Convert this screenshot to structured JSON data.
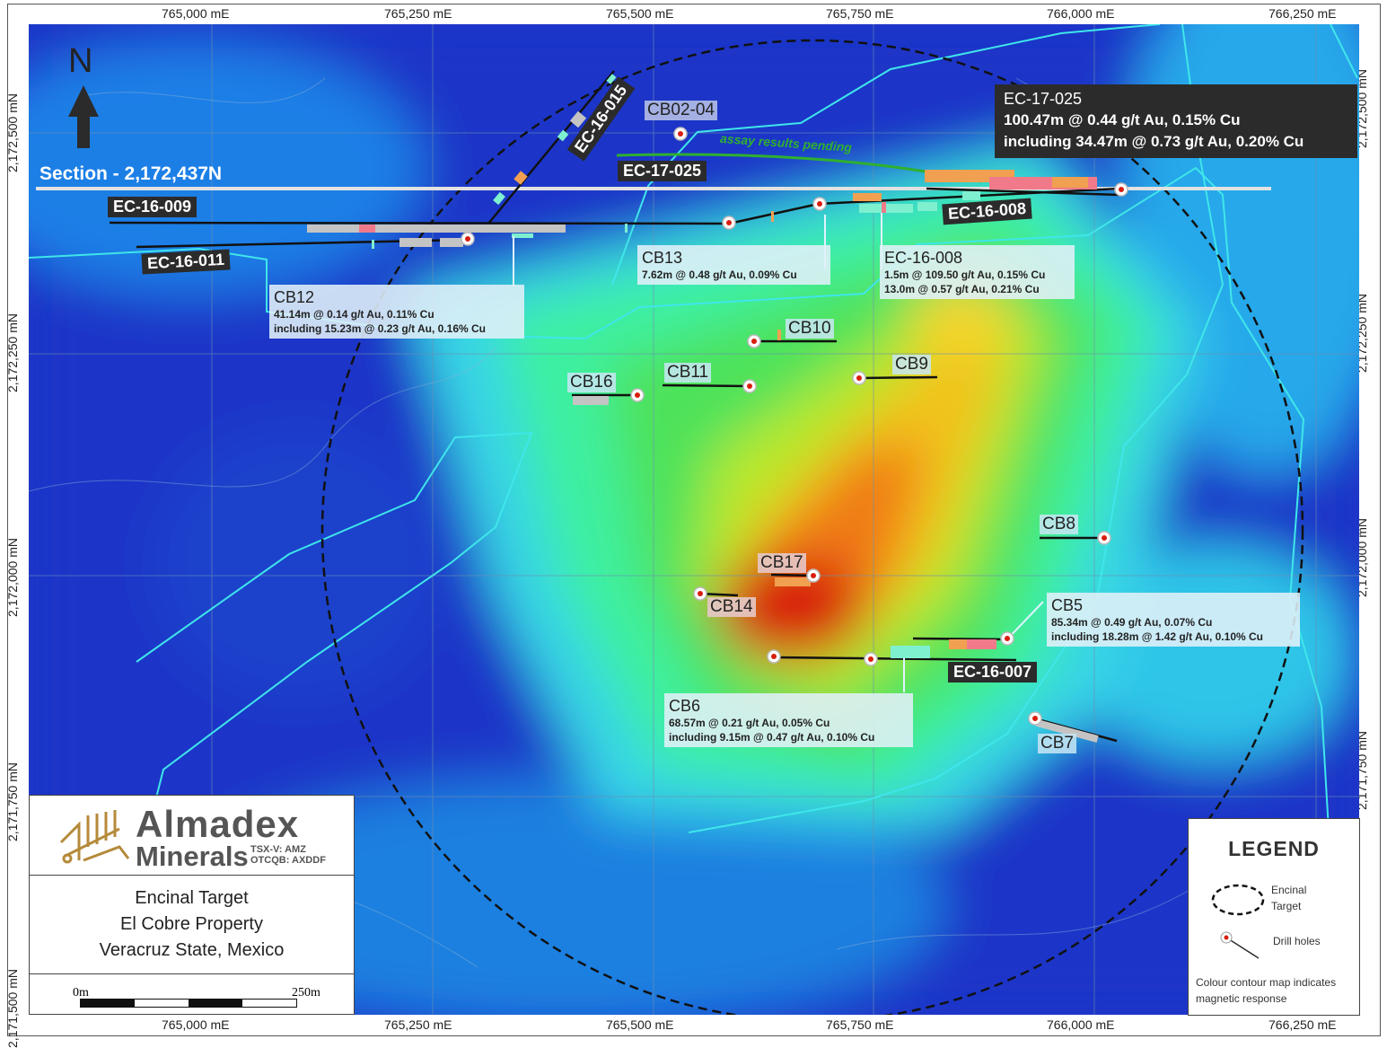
{
  "easting_labels": [
    "765,000 mE",
    "765,250 mE",
    "765,500 mE",
    "765,750 mE",
    "766,000 mE",
    "766,250 mE"
  ],
  "northing_labels": [
    "2,172,500 mN",
    "2,172,250 mN",
    "2,172,000 mN",
    "2,171,750 mN",
    "2,171,500 mN"
  ],
  "north_arrow": "N",
  "section_label": "Section - 2,172,437N",
  "assay_note": "assay results pending",
  "drill_traces": [
    "EC-16-009",
    "EC-16-011",
    "EC-16-015",
    "EC-17-025",
    "EC-16-008",
    "EC-16-007"
  ],
  "holes": [
    "CB02-04",
    "CB13",
    "CB12",
    "CB10",
    "CB9",
    "CB11",
    "CB16",
    "CB8",
    "CB17",
    "CB14",
    "CB5",
    "CB6",
    "CB7"
  ],
  "callouts": {
    "ec17025": {
      "title": "EC-17-025",
      "line1": "100.47m @ 0.44 g/t Au, 0.15% Cu",
      "line2": "including 34.47m @ 0.73 g/t Au, 0.20% Cu"
    },
    "cb13": {
      "title": "CB13",
      "line1": "7.62m @ 0.48 g/t Au, 0.09% Cu"
    },
    "ec16008": {
      "title": "EC-16-008",
      "line1": "1.5m @ 109.50 g/t Au, 0.15% Cu",
      "line2": "13.0m @ 0.57 g/t Au, 0.21% Cu"
    },
    "cb12": {
      "title": "CB12",
      "line1": "41.14m @ 0.14 g/t Au, 0.11% Cu",
      "line2": "including 15.23m @ 0.23 g/t Au, 0.16% Cu"
    },
    "cb5": {
      "title": "CB5",
      "line1": "85.34m @ 0.49 g/t Au, 0.07% Cu",
      "line2": "including 18.28m @ 1.42 g/t Au, 0.10% Cu"
    },
    "cb6": {
      "title": "CB6",
      "line1": "68.57m @ 0.21 g/t Au, 0.05% Cu",
      "line2": "including 9.15m @ 0.47 g/t Au, 0.10% Cu"
    }
  },
  "logo": {
    "name1": "Almadex",
    "name2": "Minerals",
    "ticker1": "TSX-V: AMZ",
    "ticker2": "OTCQB: AXDDF"
  },
  "title_block": [
    "Encinal Target",
    "El Cobre Property",
    "Veracruz State, Mexico"
  ],
  "scale": {
    "start": "0m",
    "end": "250m"
  },
  "legend": {
    "heading": "LEGEND",
    "target_label1": "Encinal",
    "target_label2": "Target",
    "drill_label": "Drill holes",
    "note1": "Colour contour map indicates",
    "note2": "magnetic response"
  },
  "colors": {
    "high": "#d81e0e",
    "mid": "#f2c21a",
    "low": "#1a35c8",
    "contour": "#3fe6ea"
  }
}
